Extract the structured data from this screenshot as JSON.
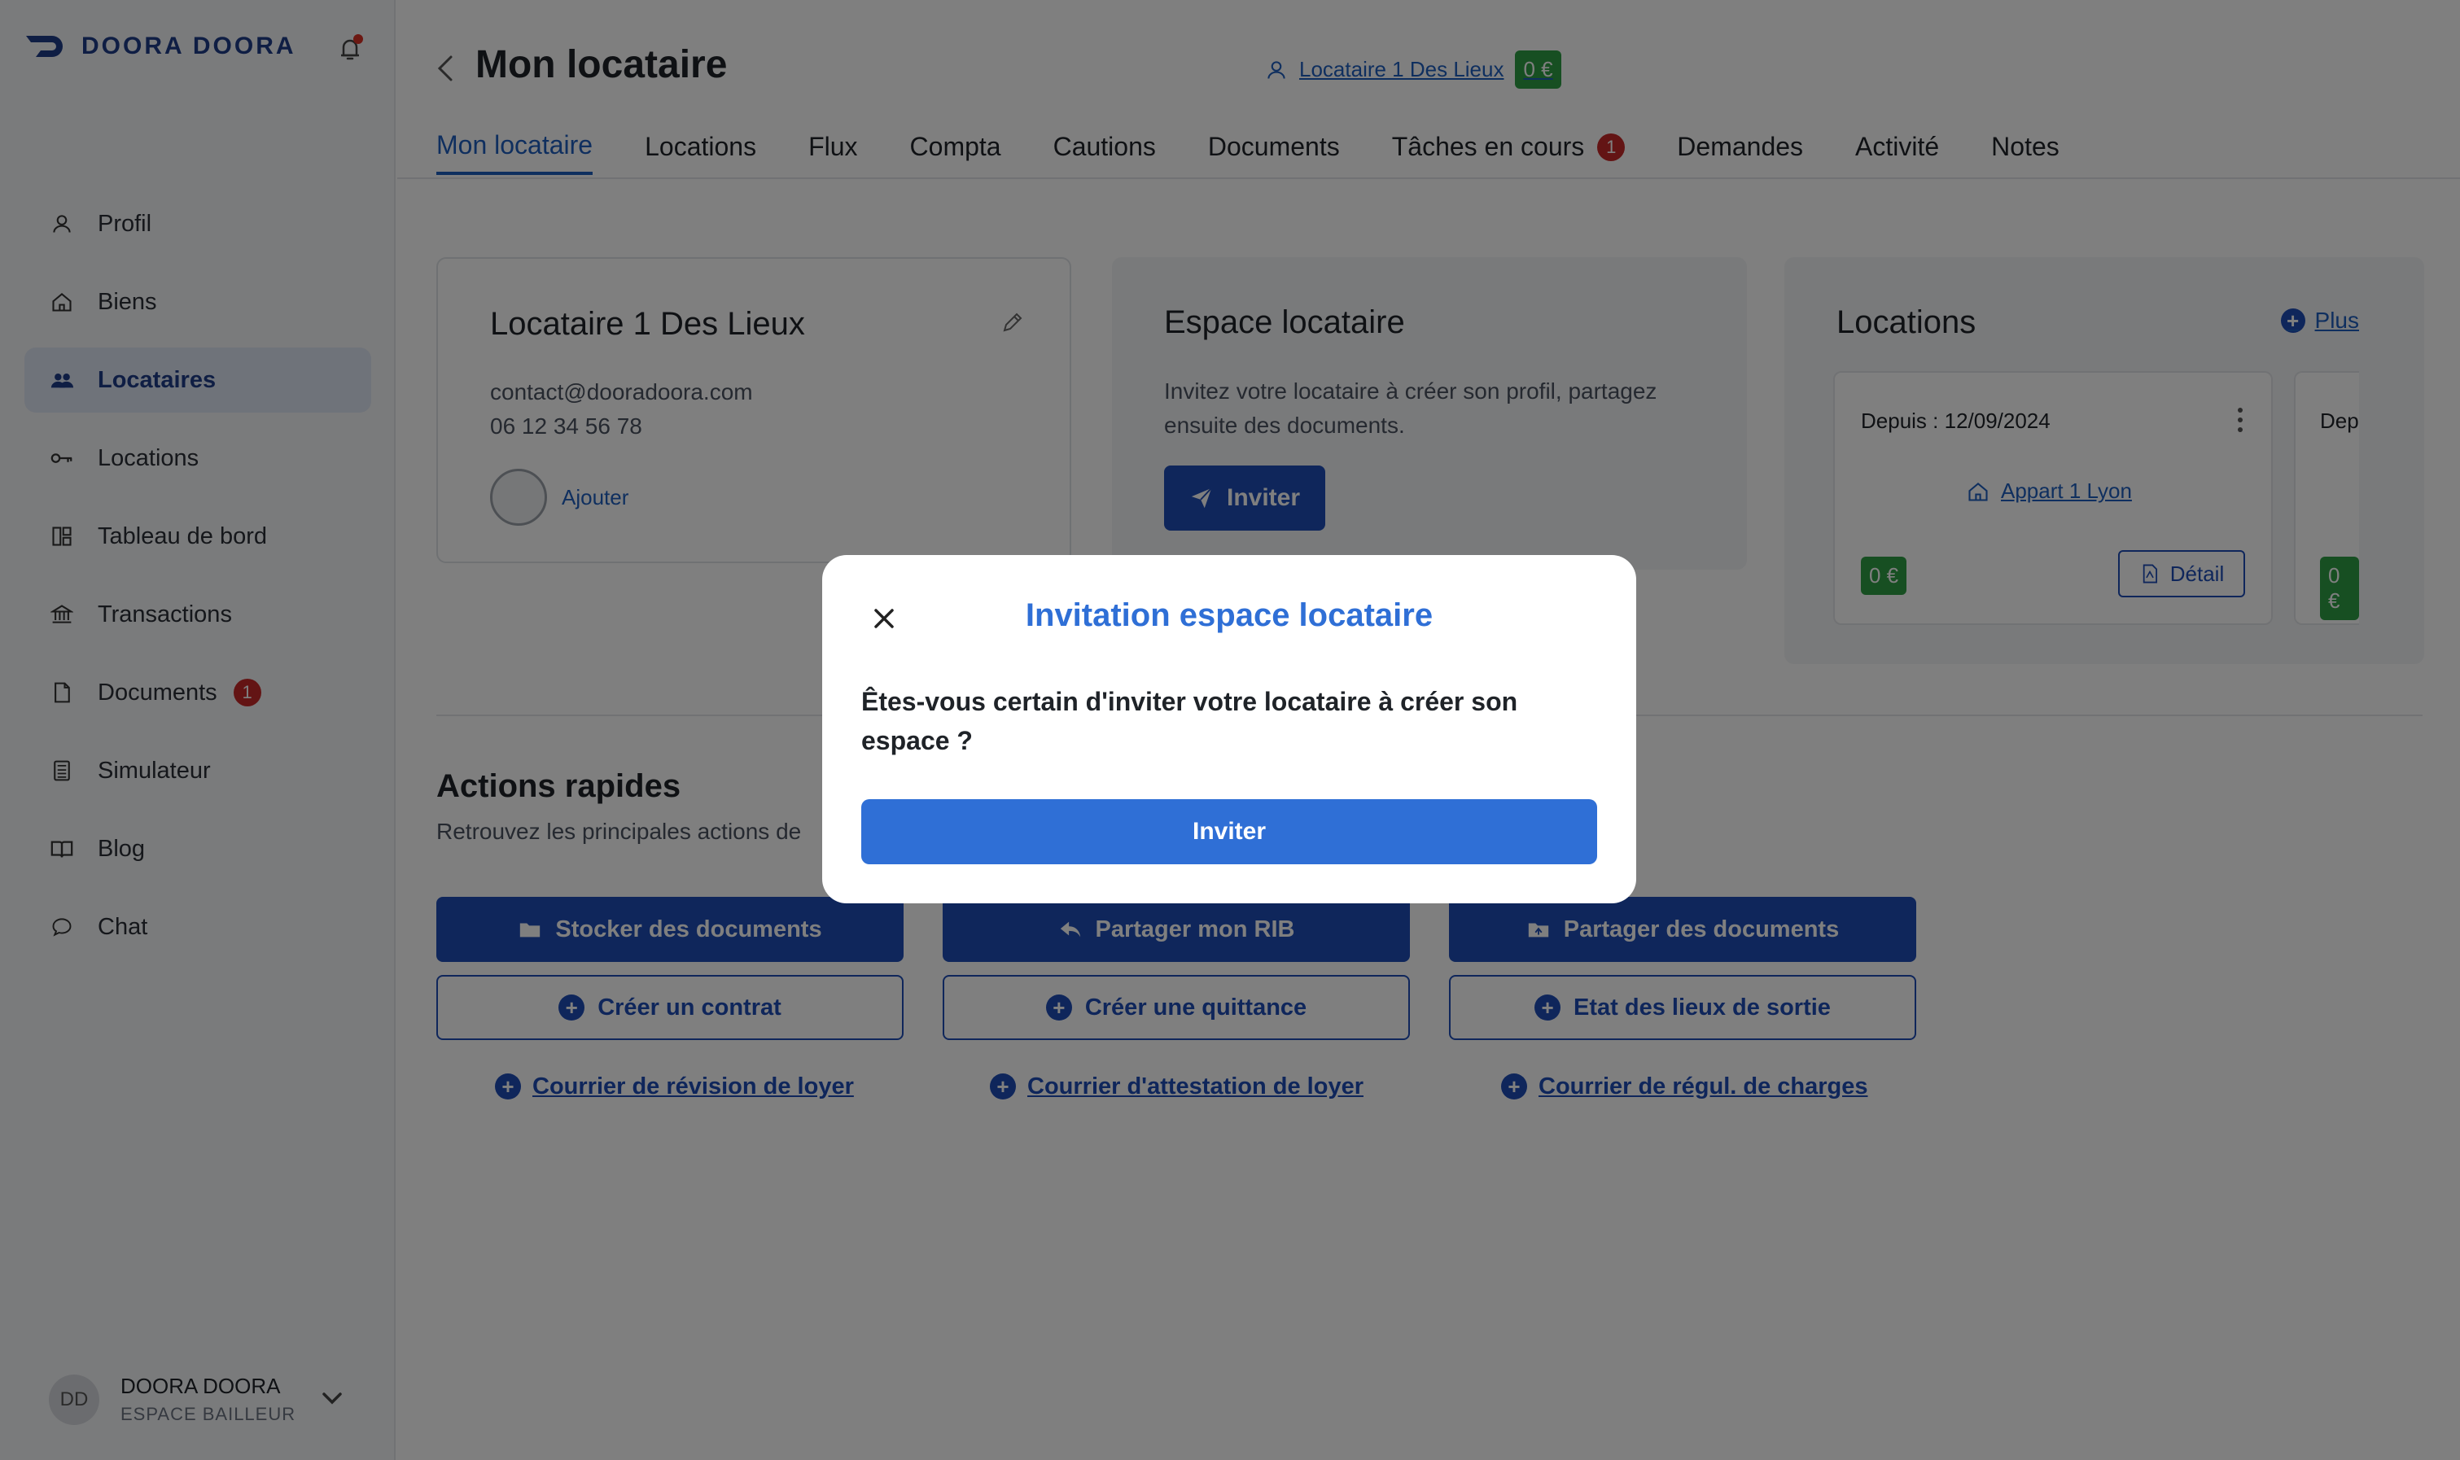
{
  "brand": {
    "name": "DOORA DOORA",
    "color": "#1f3c88"
  },
  "sidebar": {
    "items": [
      {
        "label": "Profil",
        "icon": "user-icon"
      },
      {
        "label": "Biens",
        "icon": "home-icon"
      },
      {
        "label": "Locataires",
        "icon": "users-icon",
        "active": true
      },
      {
        "label": "Locations",
        "icon": "key-icon"
      },
      {
        "label": "Tableau de bord",
        "icon": "dashboard-icon"
      },
      {
        "label": "Transactions",
        "icon": "bank-icon"
      },
      {
        "label": "Documents",
        "icon": "document-icon",
        "badge": "1"
      },
      {
        "label": "Simulateur",
        "icon": "calculator-icon"
      },
      {
        "label": "Blog",
        "icon": "book-icon"
      },
      {
        "label": "Chat",
        "icon": "chat-icon"
      }
    ],
    "user": {
      "initials": "DD",
      "name": "DOORA DOORA",
      "role": "ESPACE BAILLEUR"
    }
  },
  "header": {
    "title": "Mon locataire",
    "tenant_link": "Locataire 1 Des Lieux",
    "tenant_balance": "0 €"
  },
  "tabs": [
    {
      "label": "Mon locataire",
      "active": true
    },
    {
      "label": "Locations"
    },
    {
      "label": "Flux"
    },
    {
      "label": "Compta"
    },
    {
      "label": "Cautions"
    },
    {
      "label": "Documents"
    },
    {
      "label": "Tâches en cours",
      "badge": "1"
    },
    {
      "label": "Demandes"
    },
    {
      "label": "Activité"
    },
    {
      "label": "Notes"
    }
  ],
  "tenant_card": {
    "name": "Locataire 1 Des Lieux",
    "email": "contact@dooradoora.com",
    "phone": "06 12 34 56 78",
    "add_label": "Ajouter"
  },
  "space_card": {
    "title": "Espace locataire",
    "description": "Invitez votre locataire à créer son profil, partagez ensuite des documents.",
    "invite_label": "Inviter"
  },
  "locations_card": {
    "title": "Locations",
    "plus_label": "Plus",
    "items": [
      {
        "since": "Depuis : 12/09/2024",
        "property": "Appart 1 Lyon",
        "amount": "0 €",
        "detail_label": "Détail"
      },
      {
        "since": "Dep",
        "amount": "0 €"
      }
    ]
  },
  "quick_actions": {
    "title": "Actions rapides",
    "subtitle": "Retrouvez les principales actions de",
    "primary": [
      "Stocker des documents",
      "Partager mon RIB",
      "Partager des documents"
    ],
    "secondary": [
      "Créer un contrat",
      "Créer une quittance",
      "Etat des lieux de sortie"
    ],
    "links": [
      "Courrier de révision de loyer",
      "Courrier d'attestation de loyer",
      "Courrier de régul. de charges"
    ]
  },
  "modal": {
    "title": "Invitation espace locataire",
    "text": "Êtes-vous certain d'inviter votre locataire à créer son espace ?",
    "confirm_label": "Inviter"
  },
  "colors": {
    "primary": "#1e4db7",
    "accent": "#2f6fd6",
    "success": "#2e9e44",
    "danger": "#c62828"
  }
}
